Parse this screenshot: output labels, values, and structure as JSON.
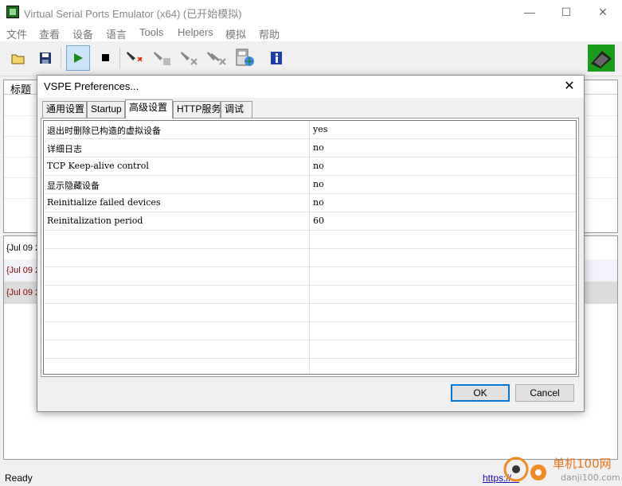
{
  "window": {
    "title": "Virtual Serial Ports Emulator (x64) (已开始模拟)"
  },
  "window_controls": {
    "minimize": "—",
    "maximize": "☐",
    "close": "✕"
  },
  "menu": [
    "文件",
    "查看",
    "设备",
    "语言",
    "Tools",
    "Helpers",
    "模拟",
    "帮助"
  ],
  "toolbar": {
    "icons": [
      "open-icon",
      "save-icon",
      "play-icon",
      "stop-icon",
      "add-device-icon",
      "edit-device-icon",
      "remove-device-icon",
      "remove-all-icon",
      "terminal-icon",
      "about-icon"
    ]
  },
  "background": {
    "table_header": "标题",
    "log_rows": [
      {
        "text": "{Jul 09 2",
        "color": "#000000"
      },
      {
        "text": "{Jul 09 2",
        "color": "#8b0000"
      },
      {
        "text": "{Jul 09 2",
        "color": "#8b0000"
      }
    ]
  },
  "status": {
    "text": "Ready",
    "link": "https://..."
  },
  "watermark": {
    "text": "单机100网",
    "sub": "danji100.com"
  },
  "dialog": {
    "title": "VSPE Preferences...",
    "close": "✕",
    "tabs": [
      "通用设置",
      "Startup",
      "高级设置",
      "HTTP服务",
      "调试"
    ],
    "selected_tab": "高级设置",
    "rows": [
      {
        "key": "退出时删除已构造的虚拟设备",
        "value": "yes"
      },
      {
        "key": "详细日志",
        "value": "no"
      },
      {
        "key": "TCP Keep-alive control",
        "value": "no"
      },
      {
        "key": "显示隐藏设备",
        "value": "no"
      },
      {
        "key": "Reinitialize failed devices",
        "value": "no"
      },
      {
        "key": "Reinitalization period",
        "value": "60"
      }
    ],
    "ok": "OK",
    "cancel": "Cancel"
  }
}
